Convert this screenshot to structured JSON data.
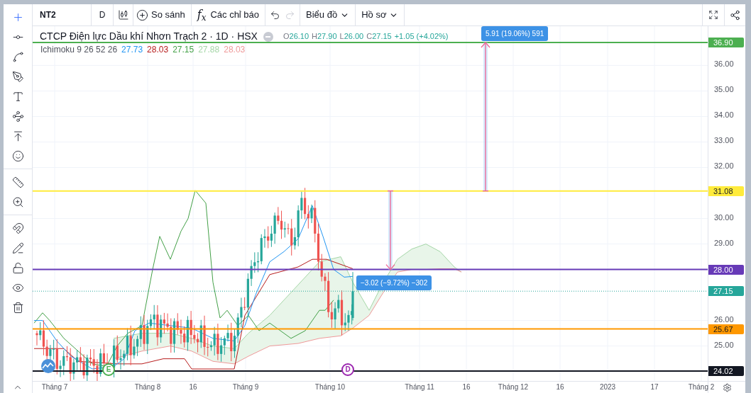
{
  "toolbar": {
    "symbol": "NT2",
    "interval": "D",
    "compare": "So sánh",
    "indicators_glyph": "f$_{x}$",
    "indicators": "Các chỉ báo",
    "redo_disabled": true,
    "chart_menu": "Biểu đồ",
    "profile_menu": "Hồ sơ"
  },
  "legend": {
    "title": "CTCP Điện lực Dầu khí Nhơn Trạch 2 · 1D · HSX",
    "ohlc": [
      {
        "label": "O",
        "value": "26.10"
      },
      {
        "label": "H",
        "value": "27.90"
      },
      {
        "label": "L",
        "value": "26.00"
      },
      {
        "label": "C",
        "value": "27.15"
      }
    ],
    "change": "+1.05 (+4.02%)"
  },
  "indicator": {
    "name": "Ichimoku 9 26 52 26",
    "values": [
      {
        "value": "27.73",
        "color": "#2196f3"
      },
      {
        "value": "28.03",
        "color": "#b71c1c"
      },
      {
        "value": "27.15",
        "color": "#43a047"
      },
      {
        "value": "27.88",
        "color": "#a5d6a7"
      },
      {
        "value": "28.03",
        "color": "#ef9a9a"
      }
    ]
  },
  "price_lines": [
    {
      "kind": "level",
      "price": "36.90",
      "color": "#4caf50"
    },
    {
      "kind": "level",
      "price": "31.08",
      "color": "#ffeb3b"
    },
    {
      "kind": "level",
      "price": "28.00",
      "color": "#673ab7"
    },
    {
      "kind": "last",
      "price": "27.15",
      "color": "#26a69a"
    },
    {
      "kind": "level",
      "price": "25.67",
      "color": "#ff9800"
    },
    {
      "kind": "level",
      "price": "24.02",
      "color": "#131722"
    }
  ],
  "measures": [
    {
      "label": "5.91 (19.06%) 591"
    },
    {
      "label": "−3.02 (−9.72%) −302"
    }
  ],
  "markers": [
    {
      "letter": "E",
      "color": "#4caf50"
    },
    {
      "letter": "D",
      "color": "#9c27b0"
    }
  ],
  "price_ticks": [
    "36.00",
    "35.00",
    "34.00",
    "33.00",
    "32.00",
    "30.00",
    "29.00",
    "26.00",
    "25.00"
  ],
  "time_ticks": [
    "Tháng 7",
    "Tháng 8",
    "16",
    "Tháng 9",
    "Tháng 10",
    "Tháng 11",
    "16",
    "Tháng 12",
    "16",
    "2023",
    "17",
    "Tháng 2"
  ]
}
